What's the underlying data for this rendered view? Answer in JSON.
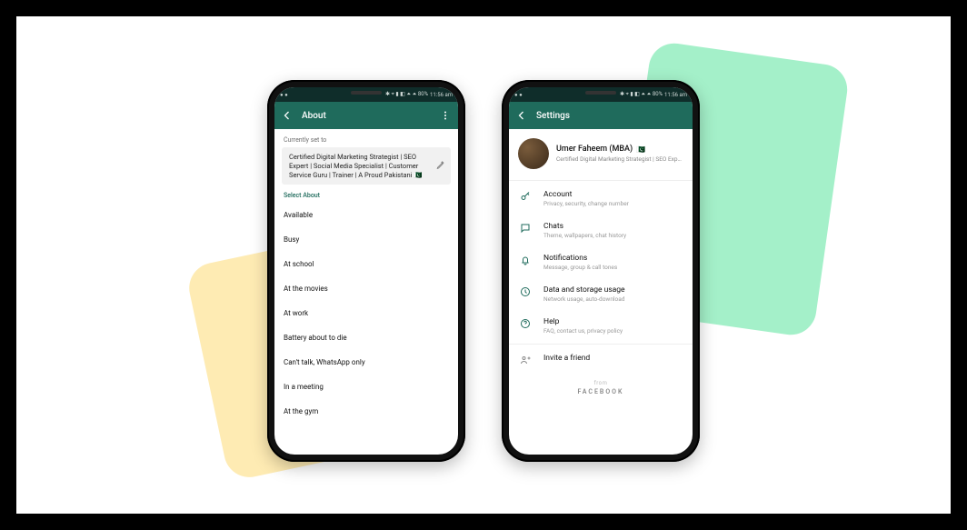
{
  "statusbar": {
    "left_dots": "● ●",
    "icons": "✱ ⌖ ▮ ◧ ⏶ ⏶ 80%",
    "time": "11:56 am"
  },
  "phone_about": {
    "appbar_title": "About",
    "currently_label": "Currently set to",
    "current_text": "Certified Digital Marketing Strategist | SEO Expert | Social Media Specialist | Customer Service Guru | Trainer | A Proud Pakistani 🇵🇰",
    "select_label": "Select About",
    "options": [
      "Available",
      "Busy",
      "At school",
      "At the movies",
      "At work",
      "Battery about to die",
      "Can't talk, WhatsApp only",
      "In a meeting",
      "At the gym"
    ]
  },
  "phone_settings": {
    "appbar_title": "Settings",
    "profile": {
      "name": "Umer Faheem (MBA)",
      "flag": "🇵🇰",
      "sub": "Certified Digital Marketing Strategist | SEO Exp…"
    },
    "items": [
      {
        "icon": "key",
        "title": "Account",
        "sub": "Privacy, security, change number"
      },
      {
        "icon": "chat",
        "title": "Chats",
        "sub": "Theme, wallpapers, chat history"
      },
      {
        "icon": "bell",
        "title": "Notifications",
        "sub": "Message, group & call tones"
      },
      {
        "icon": "data",
        "title": "Data and storage usage",
        "sub": "Network usage, auto-download"
      },
      {
        "icon": "help",
        "title": "Help",
        "sub": "FAQ, contact us, privacy policy"
      },
      {
        "icon": "invite",
        "title": "Invite a friend",
        "sub": ""
      }
    ],
    "footer_from": "from",
    "footer_brand": "FACEBOOK"
  }
}
